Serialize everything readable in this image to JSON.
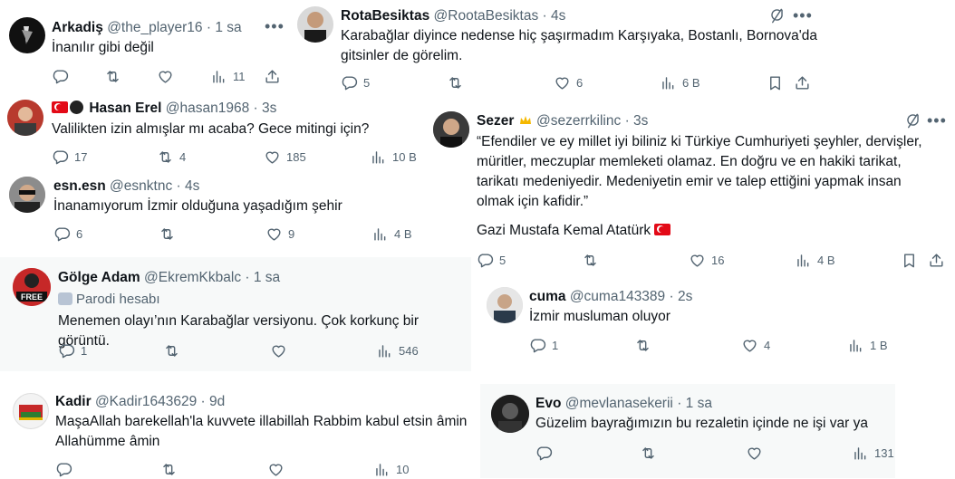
{
  "tweets": {
    "arkadis": {
      "name": "Arkadiş",
      "handle": "@the_player16",
      "time": "· 1 sa",
      "text": "İnanılır gibi değil",
      "reply": "",
      "retweet": "",
      "like": "",
      "views": "11"
    },
    "hasan": {
      "name": "Hasan Erel",
      "handle": "@hasan1968",
      "time": "· 3s",
      "text": "Valilikten izin almışlar mı acaba? Gece mitingi için?",
      "reply": "17",
      "retweet": "4",
      "like": "185",
      "views": "10 B"
    },
    "esn": {
      "name": "esn.esn",
      "handle": "@esnktnc",
      "time": "· 4s",
      "text": "İnanamıyorum İzmir olduğuna yaşadığım şehir",
      "reply": "6",
      "retweet": "",
      "like": "9",
      "views": "4 B"
    },
    "golge": {
      "name": "Gölge Adam",
      "handle": "@EkremKkbalc",
      "time": "· 1 sa",
      "parody": "Parodi hesabı",
      "text": "Menemen olayı’nın Karabağlar versiyonu. Çok korkunç bir görüntü.",
      "reply": "1",
      "retweet": "",
      "like": "",
      "views": "546"
    },
    "kadir": {
      "name": "Kadir",
      "handle": "@Kadir1643629",
      "time": "· 9d",
      "text": "MaşaAllah barekellah'la kuvvete illabillah Rabbim kabul etsin âmin Allahümme âmin",
      "reply": "",
      "retweet": "",
      "like": "",
      "views": "10"
    },
    "rota": {
      "name": "RotaBesiktas",
      "handle": "@RootaBesiktas",
      "time": "· 4s",
      "text": "Karabağlar diyince nedense hiç şaşırmadım Karşıyaka, Bostanlı, Bornova'da gitsinler de görelim.",
      "reply": "5",
      "retweet": "",
      "like": "6",
      "views": "6 B"
    },
    "sezer": {
      "name": "Sezer",
      "handle": "@sezerrkilinc",
      "time": "· 3s",
      "text": "“Efendiler ve ey millet iyi biliniz ki Türkiye Cumhuriyeti şeyhler, dervişler, müritler, meczuplar memleketi olamaz. En doğru ve en hakiki tarikat, tarikatı medeniyedir. Medeniyetin emir ve talep ettiğini yapmak insan olmak için kafidir.”",
      "signature": "Gazi Mustafa Kemal Atatürk",
      "reply": "5",
      "retweet": "",
      "like": "16",
      "views": "4 B"
    },
    "cuma": {
      "name": "cuma",
      "handle": "@cuma143389",
      "time": "· 2s",
      "text": "İzmir musluman oluyor",
      "reply": "1",
      "retweet": "",
      "like": "4",
      "views": "1 B"
    },
    "evo": {
      "name": "Evo",
      "handle": "@mevlanasekerii",
      "time": "· 1 sa",
      "text": "Güzelim bayrağımızın bu rezaletin içinde ne işi var ya",
      "reply": "",
      "retweet": "",
      "like": "",
      "views": "131"
    }
  },
  "icons": {
    "reply": "reply-icon",
    "retweet": "retweet-icon",
    "like": "heart-icon",
    "views": "views-icon",
    "bookmark": "bookmark-icon",
    "share": "share-icon",
    "more": "more-icon",
    "grok": "grok-icon"
  },
  "colors": {
    "text": "#0f1419",
    "secondary": "#536471",
    "gray_bg": "#f7f9f9",
    "flag_red": "#e30a17"
  }
}
